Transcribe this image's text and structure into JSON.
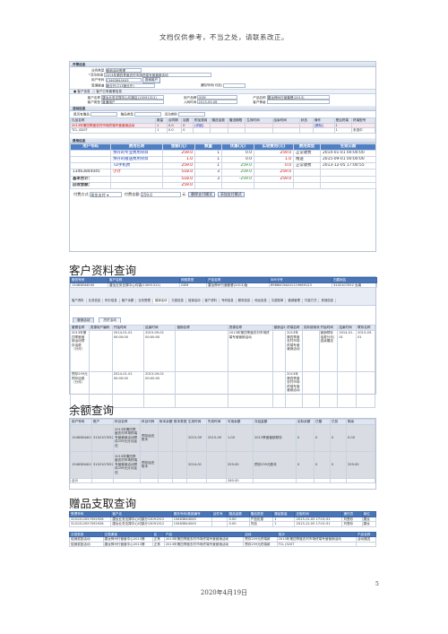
{
  "header_note": "文档仅供参考，不当之处，请联系改正。",
  "order_form": {
    "section_title": "开票信息",
    "fields": [
      {
        "label": "业务类型",
        "value": "营销活动受理"
      },
      {
        "label": "*活动信息",
        "value": "2013年第四季度农村市场终端专营营销活动"
      },
      {
        "label": "用户号码",
        "value": "13463844045"
      },
      {
        "label": "受理渠道",
        "value": "营业厅(213营业厅)"
      }
    ],
    "query_button": "查询用户",
    "confirm_button": "确认(F1)",
    "extra_label": "通知号码(可选)",
    "customer_tabs": [
      "客户信息",
      "客户已有套餐信息"
    ],
    "customer_labels": [
      "客户名称",
      "用户品牌",
      "产品名称",
      "客户类型",
      "入网时间",
      "客户等级"
    ],
    "customer_values": [
      "唐汝业务支撑中心均镇区(13091312)",
      "GSM",
      "唐汝神州行营套餐(2013)",
      "普通用户",
      "2013-09-06",
      ""
    ],
    "activity_section": "活动信息",
    "activity_labels": [
      "是否有赠品",
      "赠品类型",
      "活动类别"
    ],
    "activity_headers": [
      "礼品名称",
      "数量",
      "合同期",
      "话费",
      "附加费用",
      "赠送话费",
      "赠送期限",
      "生效时间",
      "结束时间",
      "状态",
      "操作",
      "是否终端",
      "终端型号"
    ],
    "activity_rows": [
      [
        "2013年第四季度农村市场终端专营营销活动",
        "1",
        "0.0",
        "0",
        "[详细]",
        "",
        "",
        "",
        "",
        "",
        "[删除]",
        "1",
        "",
        ""
      ],
      [
        "TCL J320T",
        "1",
        "0.0",
        "0",
        "",
        "",
        "",
        "",
        "",
        "",
        "",
        "1",
        "未选中"
      ]
    ],
    "fee_section": "费用信息",
    "fee_headers": [
      "用户号码",
      "费用名称",
      "金额(元)",
      "数量",
      "优惠(元)",
      "实收费用(元)",
      "费用类型",
      "生效日期"
    ],
    "fee_rows": [
      {
        "phone": "",
        "name": "预存的专业费用项目",
        "amount": "259.0",
        "qty": "1",
        "discount": "0.0",
        "paid": "259.0",
        "type": "正常收费",
        "date": "2014-01-01 00:00:00"
      },
      {
        "phone": "",
        "name": "预存的赠送费用项目",
        "amount": "1.0",
        "qty": "1",
        "discount": "0.0",
        "paid": "1.0",
        "type": "赠送",
        "date": "2015-09-01 00:00:00"
      },
      {
        "phone": "",
        "name": "TD手机费",
        "amount": "259.0",
        "qty": "1",
        "discount": "259.0",
        "paid": "0.0",
        "type": "正常收费",
        "date": "2013-12-05 17:00:55"
      },
      {
        "phone": "13463844045",
        "name": "小计",
        "amount": "518.0",
        "qty": "3",
        "discount": "259.0",
        "paid": "259.0",
        "type": "",
        "date": ""
      }
    ],
    "totals": [
      {
        "label": "基本合计：",
        "amount": "518.0",
        "qty": "3",
        "discount": "-259.0",
        "paid": "259.0"
      },
      {
        "label": "应收金额：",
        "amount": "259.0"
      }
    ],
    "payment": {
      "method_label": "付费方式",
      "method_value": "现金支付",
      "amount_label": "付费金额",
      "amount_value": "259.0",
      "unit": "元"
    },
    "payment_buttons": [
      "删除支付模式",
      "添加支付模式"
    ]
  },
  "headings": {
    "customer_query": "客户资料查询",
    "balance_query": "余额查询",
    "gift_query": "赠品支取查询"
  },
  "customer_info": {
    "headers": [
      "服务号码",
      "客户名称",
      "网络类型",
      "产品名称",
      "SIM卡号",
      "归属地区"
    ],
    "values": [
      "13463844045",
      "唐汝业务支撑中心均镇(13091312)",
      "GSM",
      "唐汝神州行营套餐(2013)版",
      "89860034401119069123",
      "3102107052 汝南"
    ],
    "nav_tabs": [
      "客户资料",
      "业务信息",
      "积分信息",
      "客户余额",
      "业务受理",
      "营销活动",
      "欠费信息",
      "促销活动",
      "客户资料",
      "号码信息",
      "服务信息",
      "地址信息",
      "欠费账单",
      "营销管理",
      "付费方式",
      "其他信息"
    ],
    "subtabs": [
      "营销活动",
      "历史活动"
    ],
    "activity_headers": [
      "套餐名称",
      "资源用户编码",
      "开始时间",
      "结束时间",
      "营销名称",
      "资源名称",
      "营销活动状态",
      "终端名称",
      "实际使用状态",
      "开始时间",
      "结束时间",
      "联系名称"
    ],
    "activity_rows": [
      [
        "2013年第四季度营销活动预存话费（分月）",
        "",
        "2014-01-01 00:00:00",
        "2015-09-01 00:00:00",
        "",
        "2013年第四季度农村市场终端专营营销活动",
        "",
        "2013年第四季度农村市场终端专营营销活动",
        "",
        "营销预存话费分月/连续赠送",
        "2014-01-01",
        "2015-09-01"
      ],
      [
        "预存259元预存话费（分月）",
        "",
        "2014-01-01 00:00:00",
        "2015-09-01 00:00:00",
        "",
        "",
        "",
        "2013年第四季度农村市场终端专营营销活动",
        "",
        "",
        "",
        ""
      ]
    ]
  },
  "balance": {
    "headers": [
      "用户号码",
      "账户",
      "科目名称",
      "科目代码",
      "帐本余额",
      "账本类型",
      "生效时间",
      "失效时间",
      "可用余额",
      "冻结金额",
      "实际余额",
      "已赠",
      "已扣",
      "剩余"
    ],
    "rows": [
      [
        "13463844045",
        "3102107052136",
        "2013年第四季度农村市场终端专营营销活动预存259元分月返还",
        "预存返还账本",
        "",
        "",
        "2015-09",
        "2015-09",
        "1.00",
        "2013季度营销预存",
        "0",
        "0",
        "0",
        "0.00"
      ],
      [
        "13463844045",
        "3102107052136",
        "2013年第四季度农村市场终端专营营销活动预存259元分月返还",
        "预存返还账本",
        "",
        "",
        "2014-01",
        "",
        "259.00",
        "预存259元账本",
        "0",
        "0",
        "0",
        "259.00"
      ],
      [
        "合计",
        "",
        "",
        "",
        "",
        "",
        "",
        "",
        "260.00",
        "",
        "",
        "",
        "",
        ""
      ]
    ]
  },
  "gifts": {
    "headers": [
      "受理号码",
      "客户名",
      "服务号码/集团编号",
      "证件号",
      "赠品金额",
      "赠品类型",
      "赠品数量",
      "支取时间",
      "操作员",
      "单位"
    ],
    "rows": [
      [
        "3101312057092926",
        "唐汝业务支撑中心均镇分13091312",
        "13463844045",
        "",
        "0.00",
        "产品优惠",
        "1",
        "2013-12-05 17:01:51",
        "刘慧珍",
        "唐汝"
      ],
      [
        "3101312057092926",
        "唐汝业务支撑中心均镇分13091312",
        "13463844045",
        "",
        "0.00",
        "货品",
        "1",
        "2013-12-05 17:01:51",
        "刘慧珍",
        "唐汝"
      ]
    ],
    "detail_headers": [
      "交易类型",
      "交易渠道",
      "区",
      "产品",
      "活动",
      "档次",
      "产品名称"
    ],
    "detail_rows": [
      [
        "促销奖励活动",
        "唐汝神州行营营中心2013第",
        "正常",
        "2013年第四季度农村市场终端专营营销活动",
        "预存259元终端款",
        "2013年第四季度农村市场终端专营营销活动",
        "活动赠送"
      ],
      [
        "促销奖励活动",
        "唐汝神州行营营中心2013第",
        "正常",
        "2013年第四季度农村市场终端专营营销活动",
        "预存259元终端款",
        "TCL J320T",
        ""
      ]
    ]
  },
  "footer": {
    "date": "2020年4月19日",
    "page": "5"
  }
}
